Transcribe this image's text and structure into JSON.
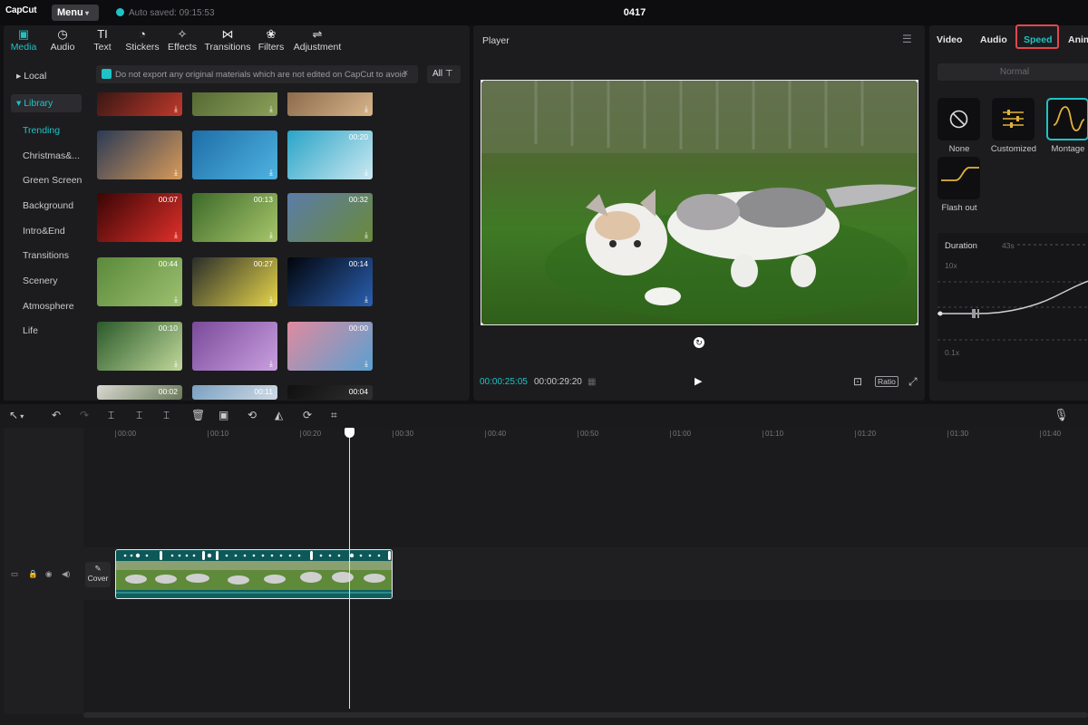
{
  "app": {
    "logo": "CapCut",
    "menu_label": "Menu",
    "autosave_text": "Auto saved: 09:15:53",
    "project_title": "0417"
  },
  "tool_tabs": [
    {
      "label": "Media",
      "icon": "media-icon",
      "glyph": "▣",
      "active": true
    },
    {
      "label": "Audio",
      "icon": "audio-icon",
      "glyph": "◷"
    },
    {
      "label": "Text",
      "icon": "text-icon",
      "glyph": "TI"
    },
    {
      "label": "Stickers",
      "icon": "sticker-icon",
      "glyph": "◔"
    },
    {
      "label": "Effects",
      "icon": "effects-icon",
      "glyph": "✧"
    },
    {
      "label": "Transitions",
      "icon": "transitions-icon",
      "glyph": "⋈"
    },
    {
      "label": "Filters",
      "icon": "filters-icon",
      "glyph": "❀"
    },
    {
      "label": "Adjustment",
      "icon": "adjustment-icon",
      "glyph": "⇌"
    }
  ],
  "sidebar": {
    "local": "Local",
    "library": "Library",
    "sub_items": [
      "Trending",
      "Christmas&...",
      "Green Screen",
      "Background",
      "Intro&End",
      "Transitions",
      "Scenery",
      "Atmosphere",
      "Life"
    ]
  },
  "notice": {
    "text": "Do not export any original materials which are not edited on CapCut to avoid",
    "close": "×"
  },
  "filter": {
    "label": "All ⊤"
  },
  "media_grid": [
    {
      "dur": "",
      "colors": [
        "#1a0f0f",
        "#c0392b"
      ]
    },
    {
      "dur": "",
      "colors": [
        "#4a5e2a",
        "#8aa05a"
      ]
    },
    {
      "dur": "",
      "colors": [
        "#7a5b3e",
        "#d8b48a"
      ]
    },
    {
      "dur": "",
      "colors": [
        "#2b3a55",
        "#d89a5a"
      ]
    },
    {
      "dur": "",
      "colors": [
        "#1e6ea8",
        "#4fb3e0"
      ]
    },
    {
      "dur": "00:20",
      "colors": [
        "#2aa4c8",
        "#cbe9f0"
      ]
    },
    {
      "dur": "00:07",
      "colors": [
        "#3a0505",
        "#e0302a"
      ]
    },
    {
      "dur": "00:13",
      "colors": [
        "#3d6a2a",
        "#a7c66a"
      ]
    },
    {
      "dur": "00:32",
      "colors": [
        "#5b7ca8",
        "#6a8a3a"
      ]
    },
    {
      "dur": "00:44",
      "colors": [
        "#5a8a3a",
        "#9cc070"
      ]
    },
    {
      "dur": "00:27",
      "colors": [
        "#2a2e2a",
        "#e6d54a"
      ]
    },
    {
      "dur": "00:14",
      "colors": [
        "#02040a",
        "#2a5fb0"
      ]
    },
    {
      "dur": "00:10",
      "colors": [
        "#2a5a2a",
        "#c0d89a"
      ]
    },
    {
      "dur": "",
      "colors": [
        "#7a4a9a",
        "#c9a0e0"
      ]
    },
    {
      "dur": "00:00",
      "colors": [
        "#e08aa0",
        "#5aa0d0"
      ]
    },
    {
      "dur": "00:02",
      "colors": [
        "#d8d8d0",
        "#6a7a5a"
      ]
    },
    {
      "dur": "00:11",
      "colors": [
        "#7aa0c0",
        "#cfdae5"
      ]
    },
    {
      "dur": "00:04",
      "colors": [
        "#101010",
        "#303030"
      ]
    }
  ],
  "player": {
    "label": "Player",
    "time_current": "00:00:25:05",
    "time_total": "00:00:29:20",
    "ratio": "Ratio"
  },
  "right_panel": {
    "tabs": [
      "Video",
      "Audio",
      "Speed",
      "Anim"
    ],
    "active_tab": "Speed",
    "normal_label": "Normal",
    "presets": [
      {
        "label": "None",
        "icon": "none-icon"
      },
      {
        "label": "Customized",
        "icon": "customized-icon"
      },
      {
        "label": "Montage",
        "icon": "montage-icon",
        "selected": true
      },
      {
        "label": "Flash out",
        "icon": "flash-out-icon"
      }
    ],
    "duration_label": "Duration",
    "duration_value": "43s",
    "y_max": "10x",
    "y_min": "0.1x"
  },
  "timeline": {
    "ruler": [
      "00:00",
      "00:10",
      "00:20",
      "00:30",
      "00:40",
      "00:50",
      "01:00",
      "01:10",
      "01:20",
      "01:30",
      "01:40"
    ],
    "cover_label": "Cover"
  },
  "colors": {
    "accent": "#1fc3c6",
    "highlight": "#e0484f"
  }
}
